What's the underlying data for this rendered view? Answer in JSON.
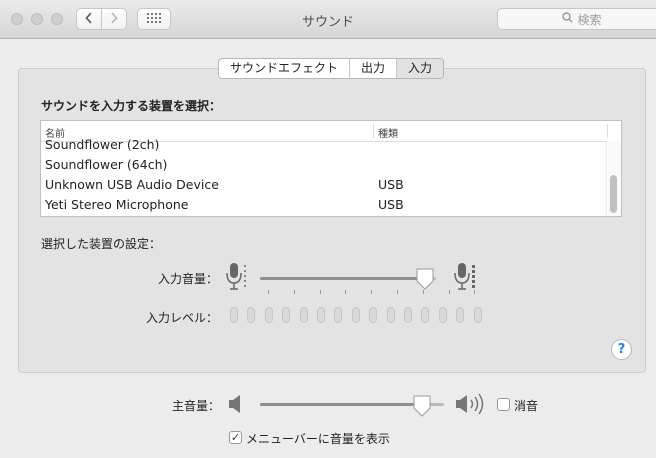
{
  "window": {
    "title": "サウンド"
  },
  "toolbar": {
    "back_icon": "chevron-left-icon",
    "forward_icon": "chevron-right-icon",
    "grid_icon": "show-all-grid-icon",
    "search_placeholder": "検索",
    "search_icon": "search-icon"
  },
  "tabs": [
    {
      "label": "サウンドエフェクト",
      "selected": false
    },
    {
      "label": "出力",
      "selected": false
    },
    {
      "label": "入力",
      "selected": true
    }
  ],
  "input": {
    "select_label": "サウンドを入力する装置を選択：",
    "columns": {
      "name": "名前",
      "type": "種類"
    },
    "devices": [
      {
        "name": "Soundflower (2ch)",
        "type": ""
      },
      {
        "name": "Soundflower (64ch)",
        "type": ""
      },
      {
        "name": "Unknown USB Audio Device",
        "type": "USB"
      },
      {
        "name": "Yeti Stereo Microphone",
        "type": "USB"
      }
    ],
    "settings_label": "選択した装置の設定：",
    "volume_label": "入力音量：",
    "volume_fraction": 0.94,
    "level_label": "入力レベル：",
    "level_segments": 15,
    "level_active": 0,
    "help_label": "?"
  },
  "output": {
    "volume_label": "主音量：",
    "volume_fraction": 0.88,
    "mute_label": "消音",
    "mute_checked": false,
    "menubar_label": "メニューバーに音量を表示",
    "menubar_checked": true
  },
  "colors": {
    "accent": "#2a7ef0",
    "track": "#b9b9b9",
    "panel": "#e3e3e3"
  }
}
